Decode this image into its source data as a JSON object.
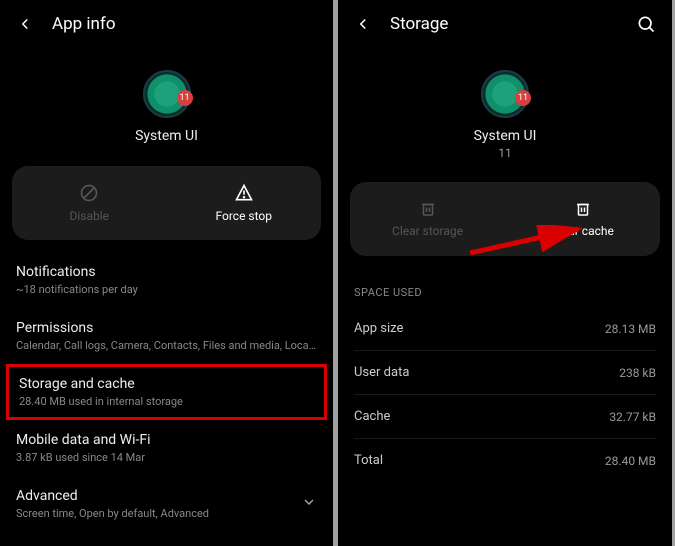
{
  "left": {
    "header_title": "App info",
    "app_name": "System UI",
    "actions": {
      "disable": "Disable",
      "force_stop": "Force stop"
    },
    "notifications": {
      "label": "Notifications",
      "sub": "~18 notifications per day"
    },
    "permissions": {
      "label": "Permissions",
      "sub": "Calendar, Call logs, Camera, Contacts, Files and media, Location, Microphon..."
    },
    "storage": {
      "label": "Storage and cache",
      "sub": "28.40 MB used in internal storage"
    },
    "mobile": {
      "label": "Mobile data and Wi-Fi",
      "sub": "3.87 kB used since 14 Mar"
    },
    "advanced": {
      "label": "Advanced",
      "sub": "Screen time, Open by default, Advanced"
    }
  },
  "right": {
    "header_title": "Storage",
    "app_name": "System UI",
    "app_version": "11",
    "actions": {
      "clear_storage": "Clear storage",
      "clear_cache": "Clear cache"
    },
    "section_header": "SPACE USED",
    "rows": {
      "app_size": {
        "k": "App size",
        "v": "28.13 MB"
      },
      "user_data": {
        "k": "User data",
        "v": "238 kB"
      },
      "cache": {
        "k": "Cache",
        "v": "32.77 kB"
      },
      "total": {
        "k": "Total",
        "v": "28.40 MB"
      }
    }
  }
}
